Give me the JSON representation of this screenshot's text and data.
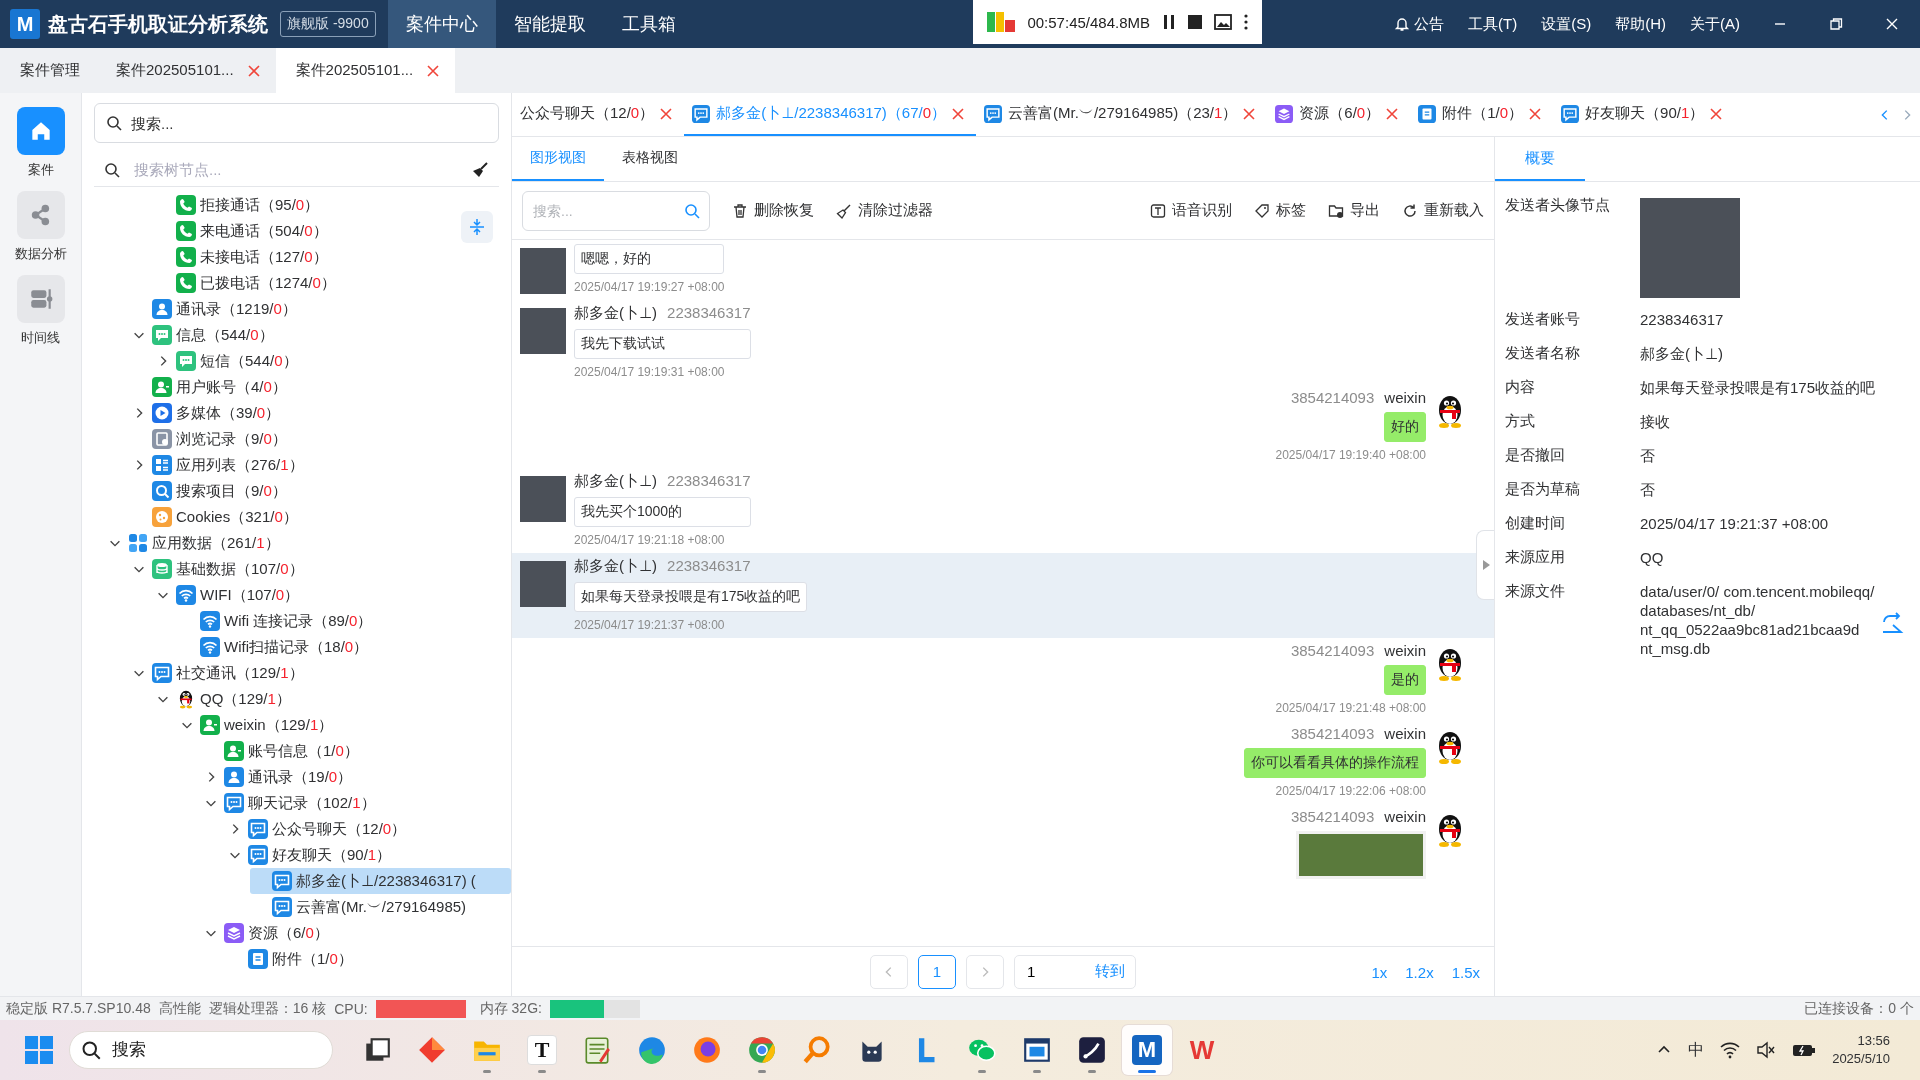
{
  "app": {
    "logo": "M",
    "title": "盘古石手机取证分析系统",
    "edition": "旗舰版 -9900",
    "nav": [
      {
        "label": "案件中心",
        "selected": true
      },
      {
        "label": "智能提取",
        "selected": false
      },
      {
        "label": "工具箱",
        "selected": false
      }
    ],
    "recorder": {
      "time": "00:57:45/484.8MB"
    },
    "notice": "公告",
    "menu": [
      "工具(T)",
      "设置(S)",
      "帮助(H)",
      "关于(A)"
    ]
  },
  "case_tabs": [
    {
      "label": "案件管理",
      "selected": false,
      "closable": false
    },
    {
      "label": "案件202505101...",
      "selected": false,
      "closable": true
    },
    {
      "label": "案件202505101...",
      "selected": true,
      "closable": true
    }
  ],
  "rail": [
    {
      "label": "案件",
      "kind": "home",
      "selected": true
    },
    {
      "label": "数据分析",
      "kind": "share",
      "selected": false
    },
    {
      "label": "时间线",
      "kind": "timeline",
      "selected": false
    }
  ],
  "tree": {
    "search_placeholder": "搜索...",
    "filter_placeholder": "搜索树节点...",
    "items": [
      {
        "children": [
          {
            "children": [
              {
                "label": "拒接通话",
                "kind": "phone",
                "count": [
                  "（95/",
                  "0",
                  "）"
                ],
                "selected": false
              },
              {
                "label": "来电通话",
                "kind": "phone",
                "count": [
                  "（504/",
                  "0",
                  "）"
                ],
                "selected": false
              },
              {
                "label": "未接电话",
                "kind": "phone",
                "count": [
                  "（127/",
                  "0",
                  "）"
                ],
                "selected": false
              },
              {
                "label": "已拨电话",
                "kind": "phone",
                "count": [
                  "（1274/",
                  "0",
                  "）"
                ],
                "selected": false
              }
            ]
          },
          {
            "label": "通讯录",
            "kind": "contact",
            "count": [
              "（1219/",
              "0",
              "）"
            ],
            "selected": false
          },
          {
            "label": "信息",
            "kind": "message",
            "count": [
              "（544/",
              "0",
              "）"
            ],
            "expanded": true,
            "selected": false,
            "children": [
              {
                "label": "短信",
                "kind": "message",
                "count": [
                  "（544/",
                  "0",
                  "）"
                ],
                "expanded": false,
                "selected": false
              }
            ]
          },
          {
            "label": "用户账号",
            "kind": "account",
            "count": [
              "（4/",
              "0",
              "）"
            ],
            "selected": false
          },
          {
            "label": "多媒体",
            "kind": "media",
            "count": [
              "（39/",
              "0",
              "）"
            ],
            "expanded": false,
            "selected": false
          },
          {
            "label": "浏览记录",
            "kind": "history",
            "count": [
              "（9/",
              "0",
              "）"
            ],
            "selected": false
          },
          {
            "label": "应用列表",
            "kind": "apps",
            "count": [
              "（276/",
              "1",
              "）"
            ],
            "expanded": false,
            "selected": false
          },
          {
            "label": "搜索项目",
            "kind": "search",
            "count": [
              "（9/",
              "0",
              "）"
            ],
            "selected": false
          },
          {
            "label": "Cookies",
            "kind": "cookie",
            "count": [
              "（321/",
              "0",
              "）"
            ],
            "selected": false
          }
        ]
      },
      {
        "label": "应用数据",
        "kind": "appdata",
        "count": [
          "（261/",
          "1",
          "）"
        ],
        "expanded": true,
        "selected": false,
        "children": [
          {
            "label": "基础数据",
            "kind": "database",
            "count": [
              "（107/",
              "0",
              "）"
            ],
            "expanded": true,
            "selected": false,
            "children": [
              {
                "label": "WIFI",
                "kind": "wifi",
                "count": [
                  "（107/",
                  "0",
                  "）"
                ],
                "expanded": true,
                "selected": false,
                "children": [
                  {
                    "label": "Wifi 连接记录",
                    "kind": "wifi",
                    "count": [
                      "（89/",
                      "0",
                      "）"
                    ],
                    "selected": false
                  },
                  {
                    "label": "Wifi扫描记录",
                    "kind": "wifi",
                    "count": [
                      "（18/",
                      "0",
                      "）"
                    ],
                    "selected": false
                  }
                ]
              }
            ]
          },
          {
            "label": "社交通讯",
            "kind": "chat",
            "count": [
              "（129/",
              "1",
              "）"
            ],
            "expanded": true,
            "selected": false,
            "children": [
              {
                "label": "QQ",
                "kind": "qq",
                "count": [
                  "（129/",
                  "1",
                  "）"
                ],
                "expanded": true,
                "selected": false,
                "children": [
                  {
                    "label": "weixin",
                    "kind": "account",
                    "count": [
                      "（129/",
                      "1",
                      "）"
                    ],
                    "expanded": true,
                    "selected": false,
                    "children": [
                      {
                        "label": "账号信息",
                        "kind": "account",
                        "count": [
                          "（1/",
                          "0",
                          "）"
                        ],
                        "selected": false
                      },
                      {
                        "label": "通讯录",
                        "kind": "contact",
                        "count": [
                          "（19/",
                          "0",
                          "）"
                        ],
                        "expanded": false,
                        "selected": false
                      },
                      {
                        "label": "聊天记录",
                        "kind": "chat",
                        "count": [
                          "（102/",
                          "1",
                          "）"
                        ],
                        "expanded": true,
                        "selected": false,
                        "children": [
                          {
                            "label": "公众号聊天",
                            "kind": "chat",
                            "count": [
                              "（12/",
                              "0",
                              "）"
                            ],
                            "expanded": false,
                            "selected": false
                          },
                          {
                            "label": "好友聊天",
                            "kind": "chat",
                            "count": [
                              "（90/",
                              "1",
                              "）"
                            ],
                            "expanded": true,
                            "selected": false,
                            "children": [
                              {
                                "label": "郝多金(卜⊥/2238346317) (",
                                "kind": "chat",
                                "selected": true
                              },
                              {
                                "label": "云善富(Mr.︶/279164985)",
                                "kind": "chat",
                                "selected": false
                              }
                            ]
                          }
                        ]
                      },
                      {
                        "label": "资源",
                        "kind": "resource",
                        "count": [
                          "（6/",
                          "0",
                          "）"
                        ],
                        "expanded": true,
                        "selected": false,
                        "children": [
                          {
                            "label": "附件",
                            "kind": "attachment",
                            "count": [
                              "（1/",
                              "0",
                              "）"
                            ],
                            "selected": false
                          }
                        ]
                      }
                    ]
                  }
                ]
              }
            ]
          }
        ]
      }
    ]
  },
  "center": {
    "tabs": [
      {
        "label": "公众号聊天",
        "count": [
          "（12/",
          "0",
          "）"
        ],
        "selected": false
      },
      {
        "label": "郝多金(卜⊥/2238346317)",
        "kind": "chat",
        "count": [
          "（67/",
          "0",
          "）"
        ],
        "selected": true
      },
      {
        "label": "云善富(Mr.︶/279164985)",
        "kind": "chat",
        "count": [
          "（23/",
          "1",
          "）"
        ],
        "selected": false
      },
      {
        "label": "资源",
        "kind": "resource",
        "count": [
          "（6/",
          "0",
          "）"
        ],
        "selected": false
      },
      {
        "label": "附件",
        "kind": "attachment",
        "count": [
          "（1/",
          "0",
          "）"
        ],
        "selected": false
      },
      {
        "label": "好友聊天",
        "kind": "chat",
        "count": [
          "（90/",
          "1",
          "）"
        ],
        "selected": false
      }
    ],
    "views": [
      {
        "label": "图形视图",
        "selected": true
      },
      {
        "label": "表格视图",
        "selected": false
      }
    ],
    "toolbar": {
      "search_placeholder": "搜索...",
      "left": [
        {
          "label": "删除恢复",
          "kind": "trash"
        },
        {
          "label": "清除过滤器",
          "kind": "broom"
        }
      ],
      "right": [
        {
          "label": "语音识别",
          "kind": "text"
        },
        {
          "label": "标签",
          "kind": "tag"
        },
        {
          "label": "导出",
          "kind": "export"
        },
        {
          "label": "重新载入",
          "kind": "reload"
        }
      ]
    },
    "messages": [
      {
        "kind": "in_text",
        "text": "嗯嗯，好的",
        "time": "2025/04/17 19:19:27 +08:00",
        "selected": false
      },
      {
        "kind": "in_text",
        "name": "郝多金(卜⊥)",
        "account": "2238346317",
        "text": "我先下载试试",
        "time": "2025/04/17 19:19:31 +08:00",
        "selected": false
      },
      {
        "kind": "out_text",
        "name": "weixin",
        "account": "3854214093",
        "text": "好的",
        "time": "2025/04/17 19:19:40 +08:00",
        "selected": false
      },
      {
        "kind": "in_text",
        "name": "郝多金(卜⊥)",
        "account": "2238346317",
        "text": "我先买个1000的",
        "time": "2025/04/17 19:21:18 +08:00",
        "selected": false
      },
      {
        "kind": "in_text",
        "name": "郝多金(卜⊥)",
        "account": "2238346317",
        "text": "如果每天登录投喂是有175收益的吧",
        "time": "2025/04/17 19:21:37 +08:00",
        "selected": true
      },
      {
        "kind": "out_text",
        "name": "weixin",
        "account": "3854214093",
        "text": "是的",
        "time": "2025/04/17 19:21:48 +08:00",
        "selected": false
      },
      {
        "kind": "out_text",
        "name": "weixin",
        "account": "3854214093",
        "text": "你可以看看具体的操作流程",
        "time": "2025/04/17 19:22:06 +08:00",
        "selected": false
      },
      {
        "kind": "out_image",
        "name": "weixin",
        "account": "3854214093",
        "selected": false
      }
    ],
    "pager": {
      "pages": [
        {
          "label": "1",
          "selected": true
        }
      ],
      "jump_value": "1",
      "jump_label": "转到",
      "zooms": [
        "1x",
        "1.2x",
        "1.5x"
      ]
    }
  },
  "detail": {
    "tabs": [
      {
        "label": "概要",
        "selected": true
      }
    ],
    "rows": [
      {
        "label": "发送者头像节点",
        "kind": "image"
      },
      {
        "label": "发送者账号",
        "kind": "text",
        "value": "2238346317"
      },
      {
        "label": "发送者名称",
        "kind": "text",
        "value": "郝多金(卜⊥)"
      },
      {
        "label": "内容",
        "kind": "text",
        "value": "如果每天登录投喂是有175收益的吧"
      },
      {
        "label": "方式",
        "kind": "text",
        "value": "接收"
      },
      {
        "label": "是否撤回",
        "kind": "text",
        "value": "否"
      },
      {
        "label": "是否为草稿",
        "kind": "text",
        "value": "否"
      },
      {
        "label": "创建时间",
        "kind": "text",
        "value": "2025/04/17 19:21:37 +08:00"
      },
      {
        "label": "来源应用",
        "kind": "text",
        "value": "QQ"
      },
      {
        "label": "来源文件",
        "kind": "text",
        "value": "data/user/0/ com.tencent.mobileqq/ databases/nt_db/ nt_qq_0522aa9bc81ad21bcaa9d nt_msg.db",
        "link": true
      }
    ]
  },
  "status_bar": {
    "version": "稳定版 R7.5.7.SP10.48",
    "mode": "高性能",
    "cores": "逻辑处理器：16 核",
    "cpu": {
      "label": "CPU:",
      "level": 1
    },
    "memory": {
      "label": "内存 32G:",
      "level": 0.6
    },
    "devices": "已连接设备：0 个"
  },
  "taskbar": {
    "search_placeholder": "搜索",
    "apps": [
      {
        "kind": "taskview",
        "running": false,
        "active": false
      },
      {
        "kind": "diamond",
        "running": false,
        "active": false
      },
      {
        "kind": "folder",
        "running": true,
        "active": false
      },
      {
        "kind": "letter",
        "glyph": "T",
        "running": true,
        "active": false
      },
      {
        "kind": "notepad",
        "running": false,
        "active": false
      },
      {
        "kind": "edge",
        "running": false,
        "active": false
      },
      {
        "kind": "firefox",
        "running": false,
        "active": false
      },
      {
        "kind": "chrome",
        "running": true,
        "active": false
      },
      {
        "kind": "magnifier",
        "running": false,
        "active": false
      },
      {
        "kind": "cat",
        "running": false,
        "active": false
      },
      {
        "kind": "lshape",
        "running": false,
        "active": false
      },
      {
        "kind": "wechat",
        "running": true,
        "active": false
      },
      {
        "kind": "window",
        "running": true,
        "active": false
      },
      {
        "kind": "pen",
        "running": true,
        "active": false
      },
      {
        "kind": "mapp",
        "glyph": "M",
        "running": true,
        "active": true
      },
      {
        "kind": "wps",
        "glyph": "W",
        "running": false,
        "active": false
      }
    ],
    "ime": "中",
    "time": "13:56",
    "date": "2025/5/10"
  }
}
